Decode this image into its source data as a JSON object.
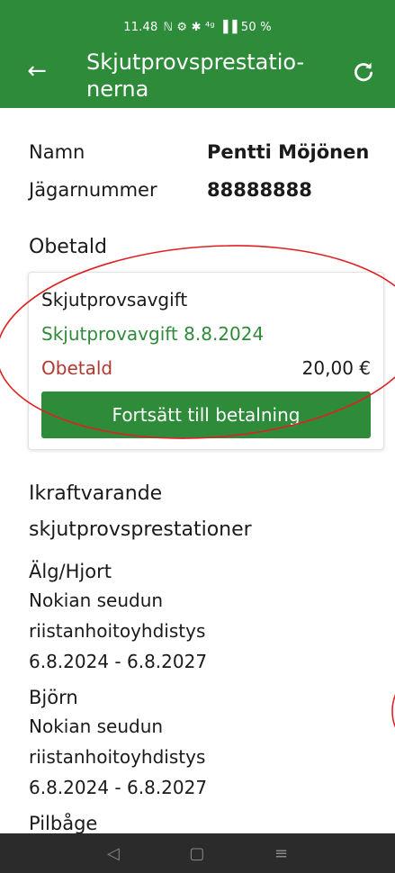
{
  "status_bar": {
    "time": "11.48",
    "right_icons": "ℕ ⚙ ✱ ⁴ᵍ ▐▐ 50 %"
  },
  "app_bar": {
    "title": "Skjutprovsprestatio-nerna"
  },
  "person": {
    "name_label": "Namn",
    "name_value": "Pentti Möjönen",
    "hunter_label": "Jägarnummer",
    "hunter_value": "88888888"
  },
  "unpaid": {
    "section_title": "Obetald",
    "card_title": "Skjutprovsavgift",
    "card_subtitle": "Skjutprovavgift 8.8.2024",
    "status": "Obetald",
    "amount": "20,00 €",
    "pay_button": "Fortsätt till betalning"
  },
  "valid": {
    "section_title_line1": "Ikraftvarande",
    "section_title_line2": "skjutprovsprestationer",
    "items": [
      {
        "title": "Älg/Hjort",
        "org_line1": "Nokian seudun",
        "org_line2": "riistanhoitoyhdistys",
        "period": "6.8.2024 - 6.8.2027"
      },
      {
        "title": "Björn",
        "org_line1": "Nokian seudun",
        "org_line2": "riistanhoitoyhdistys",
        "period": "6.8.2024 - 6.8.2027"
      }
    ],
    "cut_title": "Pilbåge"
  },
  "colors": {
    "brand_green": "#2e8b3a",
    "unpaid_red": "#b03a32",
    "annotation_red": "#e02020",
    "nav_bar": "#2b2b2b"
  },
  "icons": {
    "back": "arrow-left-icon",
    "refresh": "refresh-icon",
    "nav_back": "triangle-back-icon",
    "nav_home": "square-home-icon",
    "nav_recent": "menu-lines-icon"
  }
}
